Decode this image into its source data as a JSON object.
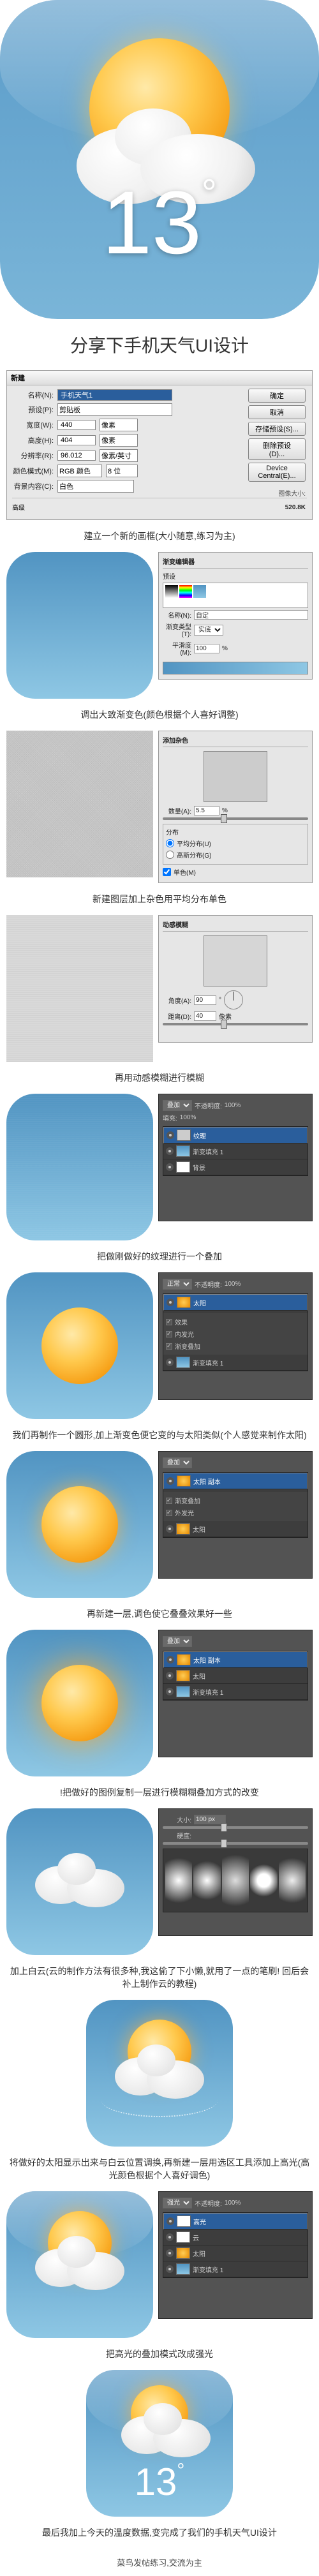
{
  "hero": {
    "temperature": "13",
    "degree": "°"
  },
  "title": "分享下手机天气UI设计",
  "newDialog": {
    "title": "新建",
    "labels": {
      "name": "名称(N):",
      "preset": "预设(P):",
      "width": "宽度(W):",
      "height": "高度(H):",
      "resolution": "分辨率(R):",
      "colorMode": "颜色模式(M):",
      "bgContent": "背景内容(C):",
      "advanced": "高级"
    },
    "values": {
      "name": "手机天气1",
      "preset": "剪贴板",
      "width": "440",
      "height": "404",
      "resolution": "96.012",
      "colorMode": "RGB 颜色",
      "bits": "8 位",
      "bgContent": "白色"
    },
    "units": {
      "px": "像素",
      "ppi": "像素/英寸"
    },
    "buttons": {
      "ok": "确定",
      "cancel": "取消",
      "savePreset": "存储预设(S)...",
      "deletePreset": "删除预设(D)...",
      "deviceCentral": "Device Central(E)..."
    },
    "sizeLabel": "图像大小:",
    "sizeValue": "520.8K"
  },
  "steps": {
    "s1": "建立一个新的画框(大小随意,练习为主)",
    "s2": "调出大致渐变色(颜色根据个人喜好调整)",
    "s3": "新建图层加上杂色用平均分布单色",
    "s4": "再用动感模糊进行模糊",
    "s5": "把做刚做好的纹理进行一个叠加",
    "s6": "我们再制作一个圆形,加上渐变色便它变的与太阳类似(个人感觉来制作太阳)",
    "s7": "再新建一层,调色使它叠叠效果好一些",
    "s8": "!把做好的图例复制一层进行模糊糊叠加方式的改变",
    "s9": "加上白云(云的制作方法有很多种,我这偷了下小懒,就用了一点的笔刷! 回后会补上制作云的教程)",
    "s10": "将做好的太阳显示出来与白云位置调换,再新建一层用选区工具添加上高光(高光颜色根据个人喜好调色)",
    "s11": "把高光的叠加模式改成强光",
    "s12": "最后我加上今天的温度数据,变完成了我们的手机天气UI设计"
  },
  "gradientPanel": {
    "title": "渐变编辑器",
    "preset": "预设",
    "name": "名称(N):",
    "nameVal": "自定",
    "type": "渐变类型(T):",
    "typeVal": "实底",
    "smooth": "平滑度(M):",
    "smoothVal": "100"
  },
  "noisePanel": {
    "title": "添加杂色",
    "amount": "数量(A):",
    "amountVal": "5.5",
    "dist": "分布",
    "uniform": "平均分布(U)",
    "gaussian": "高斯分布(G)",
    "mono": "单色(M)"
  },
  "blurPanel": {
    "title": "动感模糊",
    "angle": "角度(A):",
    "angleVal": "90",
    "distance": "距离(D):",
    "distanceVal": "40",
    "px": "像素"
  },
  "layersPanel": {
    "mode": "正常",
    "opacity": "不透明度:",
    "fill": "填充:",
    "hundred": "100%",
    "layerTex": "纹理",
    "layerGrad": "渐变填充 1",
    "layerSun": "太阳",
    "layerSun2": "太阳 副本",
    "layerCloud": "云",
    "layerHi": "高光",
    "layerBg": "背景",
    "effects": "效果",
    "innerGlow": "内发光",
    "gradOverlay": "渐变叠加",
    "outerGlow": "外发光",
    "blendOverlay": "叠加",
    "blendHard": "强光"
  },
  "brushPanel": {
    "size": "大小:",
    "sizeVal": "100 px",
    "hardness": "硬度:"
  },
  "footer": "菜鸟发帖练习,交流为主"
}
